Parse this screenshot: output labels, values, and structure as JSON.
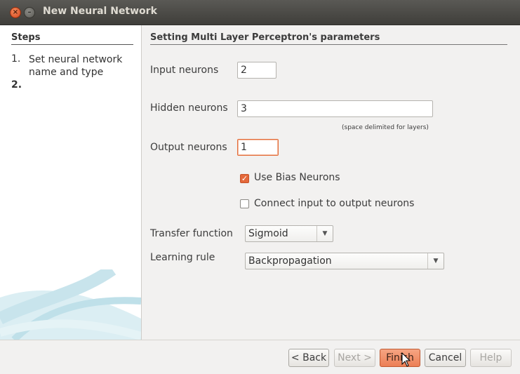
{
  "window": {
    "title": "New Neural Network"
  },
  "steps": {
    "heading": "Steps",
    "items": [
      {
        "num": "1.",
        "label": "Set neural network name and type"
      },
      {
        "num": "2.",
        "label": ""
      }
    ]
  },
  "panel": {
    "heading": "Setting Multi Layer Perceptron's parameters",
    "input_neurons": {
      "label": "Input neurons",
      "value": "2"
    },
    "hidden_neurons": {
      "label": "Hidden neurons",
      "value": "3",
      "hint": "(space delimited for layers)"
    },
    "output_neurons": {
      "label": "Output neurons",
      "value": "1"
    },
    "use_bias": {
      "label": "Use Bias Neurons",
      "checked": true
    },
    "connect_io": {
      "label": "Connect input to output neurons",
      "checked": false
    },
    "transfer_function": {
      "label": "Transfer function",
      "value": "Sigmoid"
    },
    "learning_rule": {
      "label": "Learning rule",
      "value": "Backpropagation"
    }
  },
  "footer": {
    "back": "< Back",
    "next": "Next >",
    "finish": "Finish",
    "cancel": "Cancel",
    "help": "Help"
  },
  "colors": {
    "accent": "#e4683a",
    "titlebar": "#4a4945"
  }
}
